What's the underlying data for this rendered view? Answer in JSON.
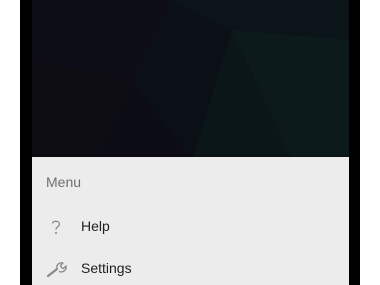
{
  "wallpaper": {
    "base_color": "#0b0c14",
    "accent_color": "#0c1a1c"
  },
  "menu_sheet": {
    "title": "Menu",
    "background": "#ececec",
    "items": [
      {
        "label": "Help",
        "icon": "help-icon"
      },
      {
        "label": "Settings",
        "icon": "wrench-icon"
      }
    ]
  }
}
